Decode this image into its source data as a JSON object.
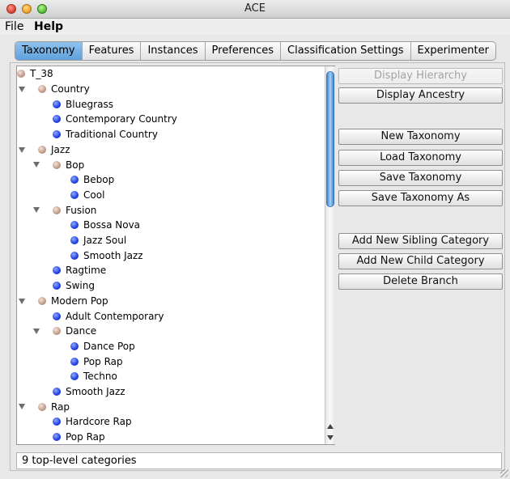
{
  "window": {
    "title": "ACE"
  },
  "menu": {
    "file": "File",
    "help": "Help"
  },
  "tabs": [
    {
      "label": "Taxonomy",
      "selected": true
    },
    {
      "label": "Features",
      "selected": false
    },
    {
      "label": "Instances",
      "selected": false
    },
    {
      "label": "Preferences",
      "selected": false
    },
    {
      "label": "Classification Settings",
      "selected": false
    },
    {
      "label": "Experimenter",
      "selected": false
    }
  ],
  "tree": [
    {
      "label": "T_38",
      "depth": 0,
      "type": "folder",
      "expanded": false,
      "root": true
    },
    {
      "label": "Country",
      "depth": 0,
      "type": "folder",
      "expanded": true
    },
    {
      "label": "Bluegrass",
      "depth": 1,
      "type": "leaf"
    },
    {
      "label": "Contemporary Country",
      "depth": 1,
      "type": "leaf"
    },
    {
      "label": "Traditional Country",
      "depth": 1,
      "type": "leaf"
    },
    {
      "label": "Jazz",
      "depth": 0,
      "type": "folder",
      "expanded": true
    },
    {
      "label": "Bop",
      "depth": 1,
      "type": "folder",
      "expanded": true
    },
    {
      "label": "Bebop",
      "depth": 2,
      "type": "leaf"
    },
    {
      "label": "Cool",
      "depth": 2,
      "type": "leaf"
    },
    {
      "label": "Fusion",
      "depth": 1,
      "type": "folder",
      "expanded": true
    },
    {
      "label": "Bossa Nova",
      "depth": 2,
      "type": "leaf"
    },
    {
      "label": "Jazz Soul",
      "depth": 2,
      "type": "leaf"
    },
    {
      "label": "Smooth Jazz",
      "depth": 2,
      "type": "leaf"
    },
    {
      "label": "Ragtime",
      "depth": 1,
      "type": "leaf"
    },
    {
      "label": "Swing",
      "depth": 1,
      "type": "leaf"
    },
    {
      "label": "Modern Pop",
      "depth": 0,
      "type": "folder",
      "expanded": true
    },
    {
      "label": "Adult Contemporary",
      "depth": 1,
      "type": "leaf"
    },
    {
      "label": "Dance",
      "depth": 1,
      "type": "folder",
      "expanded": true
    },
    {
      "label": "Dance Pop",
      "depth": 2,
      "type": "leaf"
    },
    {
      "label": "Pop Rap",
      "depth": 2,
      "type": "leaf"
    },
    {
      "label": "Techno",
      "depth": 2,
      "type": "leaf"
    },
    {
      "label": "Smooth Jazz",
      "depth": 1,
      "type": "leaf"
    },
    {
      "label": "Rap",
      "depth": 0,
      "type": "folder",
      "expanded": true
    },
    {
      "label": "Hardcore Rap",
      "depth": 1,
      "type": "leaf"
    },
    {
      "label": "Pop Rap",
      "depth": 1,
      "type": "leaf"
    }
  ],
  "buttons": {
    "display_hierarchy": "Display Hierarchy",
    "display_ancestry": "Display Ancestry",
    "new_taxonomy": "New Taxonomy",
    "load_taxonomy": "Load Taxonomy",
    "save_taxonomy": "Save Taxonomy",
    "save_taxonomy_as": "Save Taxonomy As",
    "add_sibling": "Add New Sibling Category",
    "add_child": "Add New Child Category",
    "delete_branch": "Delete Branch"
  },
  "status": "9 top-level categories"
}
